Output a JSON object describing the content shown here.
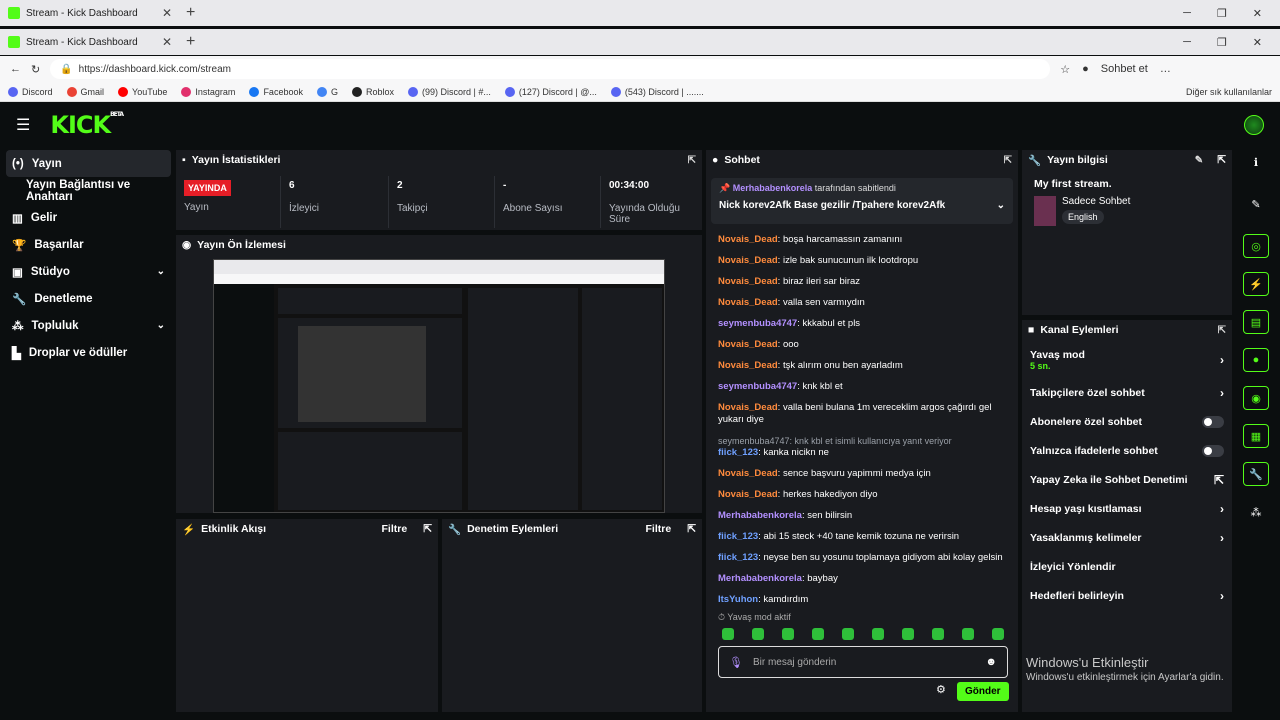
{
  "browser": {
    "tab_title": "Stream - Kick Dashboard",
    "url": "https://dashboard.kick.com/stream",
    "profile_label": "Sohbet et",
    "bookmarks": [
      "Discord",
      "Gmail",
      "YouTube",
      "Instagram",
      "Facebook",
      "G",
      "Roblox",
      "(99) Discord | #...",
      "(127) Discord | @...",
      "(543) Discord | ......."
    ],
    "bookmarks_right": "Diğer sık kullanılanlar"
  },
  "app": {
    "logo": "KICK",
    "logo_sup": "BETA"
  },
  "sidebar": [
    {
      "label": "Yayın",
      "icon": "broadcast-icon",
      "active": true
    },
    {
      "label": "Yayın Bağlantısı ve Anahtarı",
      "sub": true
    },
    {
      "label": "Gelir",
      "icon": "chart-icon"
    },
    {
      "label": "Başarılar",
      "icon": "trophy-icon"
    },
    {
      "label": "Stüdyo",
      "icon": "studio-icon",
      "chev": true
    },
    {
      "label": "Denetleme",
      "icon": "wrench-icon"
    },
    {
      "label": "Topluluk",
      "icon": "community-icon",
      "chev": true
    },
    {
      "label": "Droplar ve ödüller",
      "icon": "drops-icon"
    }
  ],
  "stats": {
    "title": "Yayın İstatistikleri",
    "items": [
      {
        "value": "YAYINDA",
        "label": "Yayın"
      },
      {
        "value": "6",
        "label": "İzleyici"
      },
      {
        "value": "2",
        "label": "Takipçi"
      },
      {
        "value": "-",
        "label": "Abone Sayısı"
      },
      {
        "value": "00:34:00",
        "label": "Yayında Olduğu Süre"
      }
    ]
  },
  "preview": {
    "title": "Yayın Ön İzlemesi"
  },
  "activity": {
    "title": "Etkinlik Akışı",
    "filter": "Filtre"
  },
  "moderation": {
    "title": "Denetim Eylemleri",
    "filter": "Filtre"
  },
  "chat": {
    "title": "Sohbet",
    "pinned_by": "Merhababenkorela",
    "pinned_suffix": "tarafından sabitlendi",
    "pinned_msg": "Nick korev2Afk Base gezilir /Tpahere korev2Afk",
    "messages": [
      {
        "user": "Novais_Dead",
        "color": "or",
        "text": "boşa harcamassın zamanını"
      },
      {
        "user": "Novais_Dead",
        "color": "or",
        "text": "izle bak sunucunun ilk lootdropu"
      },
      {
        "user": "Novais_Dead",
        "color": "or",
        "text": "biraz ileri sar biraz"
      },
      {
        "user": "Novais_Dead",
        "color": "or",
        "text": "valla sen varmıydın"
      },
      {
        "user": "seymenbuba4747",
        "color": "pu",
        "text": "kkkabul et pls"
      },
      {
        "user": "Novais_Dead",
        "color": "or",
        "text": "ooo"
      },
      {
        "user": "Novais_Dead",
        "color": "or",
        "text": "tşk alırım onu ben ayarladım"
      },
      {
        "user": "seymenbuba4747",
        "color": "pu",
        "text": "knk kbl et"
      },
      {
        "user": "Novais_Dead",
        "color": "or",
        "text": "valla beni bulana 1m vereceklim argos çağırdı gel yukarı diye"
      },
      {
        "reply": "seymenbuba4747: knk kbl et isimli kullanıcıya yanıt veriyor",
        "user": "fiick_123",
        "color": "bl",
        "text": "kanka nicikn ne"
      },
      {
        "user": "Novais_Dead",
        "color": "or",
        "text": "sence başvuru yapimmi medya için"
      },
      {
        "user": "Novais_Dead",
        "color": "or",
        "text": "herkes hakediyon diyo"
      },
      {
        "user": "Merhababenkorela",
        "color": "pu",
        "text": "sen bilirsin"
      },
      {
        "user": "fiick_123",
        "color": "bl",
        "text": "abi 15 steck +40 tane kemik tozuna ne verirsin"
      },
      {
        "user": "fiick_123",
        "color": "bl",
        "text": "neyse ben su yosunu toplamaya gidiyom abi kolay gelsin"
      },
      {
        "user": "Merhababenkorela",
        "color": "pu",
        "text": "baybay"
      },
      {
        "user": "ItsYuhon",
        "color": "bl",
        "text": "kamdırdım"
      }
    ],
    "slow_mode": "Yavaş mod aktif",
    "placeholder": "Bir mesaj gönderin",
    "send": "Gönder"
  },
  "stream_info": {
    "title": "Yayın bilgisi",
    "stream_title": "My first stream.",
    "category": "Sadece Sohbet",
    "language": "English"
  },
  "channel_actions": {
    "title": "Kanal Eylemleri",
    "items": [
      {
        "label": "Yavaş mod",
        "sub": "5 sn.",
        "type": "arrow"
      },
      {
        "label": "Takipçilere özel sohbet",
        "type": "arrow"
      },
      {
        "label": "Abonelere özel sohbet",
        "type": "toggle"
      },
      {
        "label": "Yalnızca ifadelerle sohbet",
        "type": "toggle"
      },
      {
        "label": "Yapay Zeka ile Sohbet Denetimi",
        "type": "ext"
      },
      {
        "label": "Hesap yaşı kısıtlaması",
        "type": "arrow"
      },
      {
        "label": "Yasaklanmış kelimeler",
        "type": "arrow"
      },
      {
        "label": "İzleyici Yönlendir",
        "type": "none"
      },
      {
        "label": "Hedefleri belirleyin",
        "type": "arrow"
      }
    ]
  },
  "watermark": {
    "line1": "Windows'u Etkinleştir",
    "line2": "Windows'u etkinleştirmek için Ayarlar'a gidin."
  }
}
